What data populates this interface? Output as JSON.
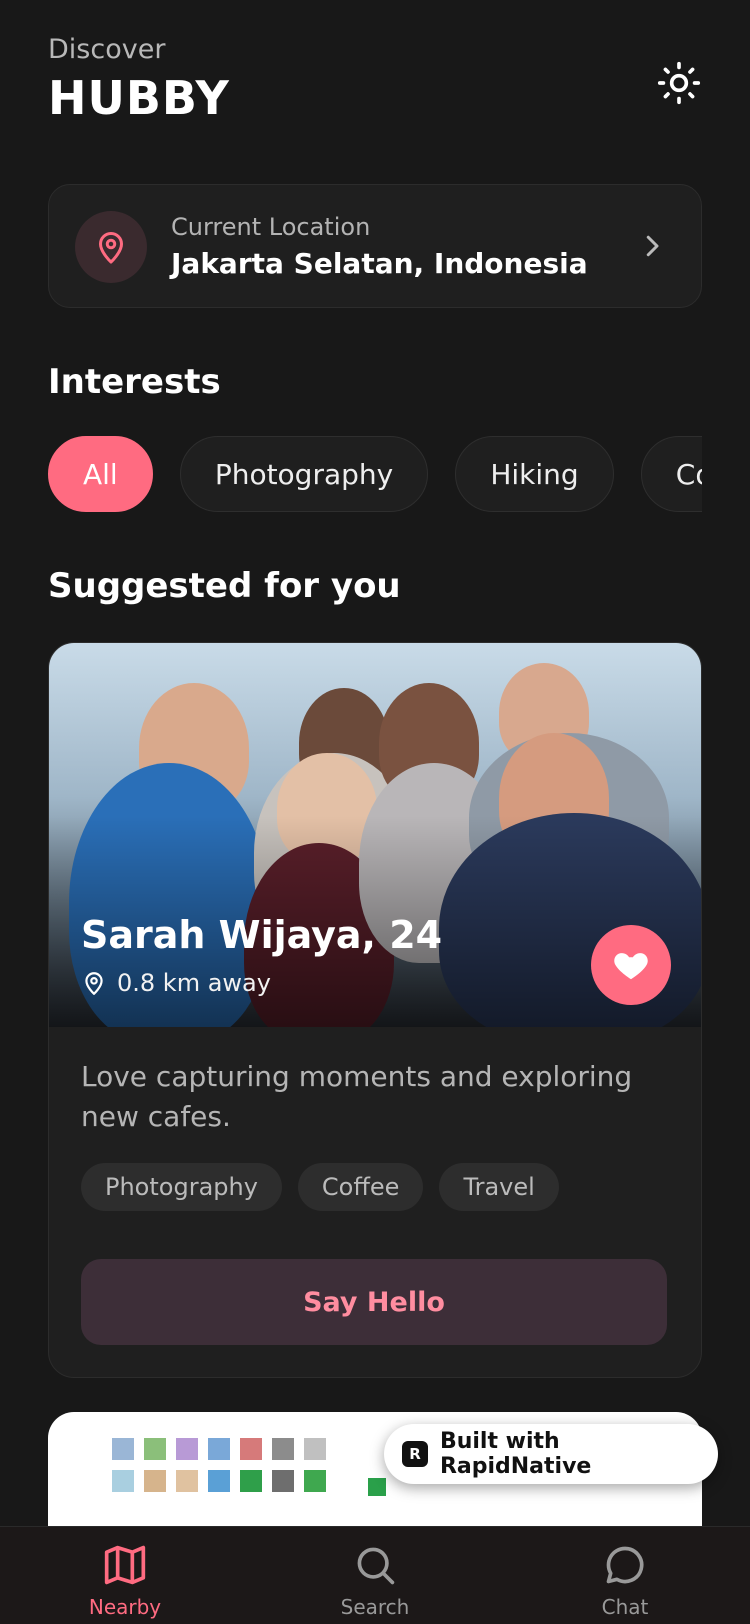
{
  "header": {
    "subtitle": "Discover",
    "title": "HUBBY",
    "theme_icon": "sun-icon"
  },
  "location": {
    "label": "Current Location",
    "value": "Jakarta Selatan, Indonesia",
    "icon": "map-pin-icon"
  },
  "interests": {
    "title": "Interests",
    "chips": [
      {
        "label": "All",
        "active": true
      },
      {
        "label": "Photography",
        "active": false
      },
      {
        "label": "Hiking",
        "active": false
      },
      {
        "label": "Coffee",
        "active": false
      }
    ]
  },
  "suggested": {
    "title": "Suggested for you",
    "card": {
      "name": "Sarah Wijaya, 24",
      "distance": "0.8 km away",
      "bio": "Love capturing moments and exploring new cafes.",
      "tags": [
        "Photography",
        "Coffee",
        "Travel"
      ],
      "cta": "Say Hello"
    }
  },
  "badge": {
    "logo": "R",
    "text": "Built with RapidNative"
  },
  "tabs": [
    {
      "label": "Nearby",
      "icon": "map-icon",
      "active": true
    },
    {
      "label": "Search",
      "icon": "search-icon",
      "active": false
    },
    {
      "label": "Chat",
      "icon": "chat-bubble-icon",
      "active": false
    }
  ],
  "colors": {
    "accent": "#ff6b81",
    "background": "#181818",
    "card": "#1f1f1f"
  }
}
